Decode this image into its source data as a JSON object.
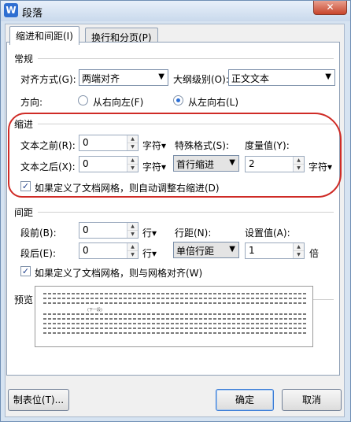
{
  "window": {
    "title": "段落",
    "close_glyph": "✕"
  },
  "tabs": [
    {
      "label": "缩进和间距(I)",
      "active": true
    },
    {
      "label": "换行和分页(P)",
      "active": false
    }
  ],
  "general": {
    "title": "常规",
    "align_label": "对齐方式(G):",
    "align_value": "两端对齐",
    "outline_label": "大纲级别(O):",
    "outline_value": "正文文本",
    "direction_label": "方向:",
    "dir_rtl": "从右向左(F)",
    "dir_ltr": "从左向右(L)"
  },
  "indent": {
    "title": "缩进",
    "before_label": "文本之前(R):",
    "before_value": "0",
    "before_unit": "字符▾",
    "special_label": "特殊格式(S):",
    "measure_label": "度量值(Y):",
    "after_label": "文本之后(X):",
    "after_value": "0",
    "after_unit": "字符▾",
    "special_value": "首行缩进",
    "measure_value": "2",
    "measure_unit": "字符▾",
    "grid_check_label": "如果定义了文档网格，则自动调整右缩进(D)"
  },
  "spacing": {
    "title": "间距",
    "before_label": "段前(B):",
    "before_value": "0",
    "before_unit": "行▾",
    "line_label": "行距(N):",
    "set_label": "设置值(A):",
    "after_label": "段后(E):",
    "after_value": "0",
    "after_unit": "行▾",
    "line_value": "单倍行距",
    "set_value": "1",
    "set_unit": "倍",
    "grid_check_label": "如果定义了文档网格，则与网格对齐(W)"
  },
  "preview": {
    "title": "预览",
    "sample_label": "(下一段)"
  },
  "footer": {
    "tabs_button": "制表位(T)...",
    "ok_button": "确定",
    "cancel_button": "取消"
  },
  "colors": {
    "highlight": "#cf2b26",
    "accent": "#2c6fd6"
  }
}
